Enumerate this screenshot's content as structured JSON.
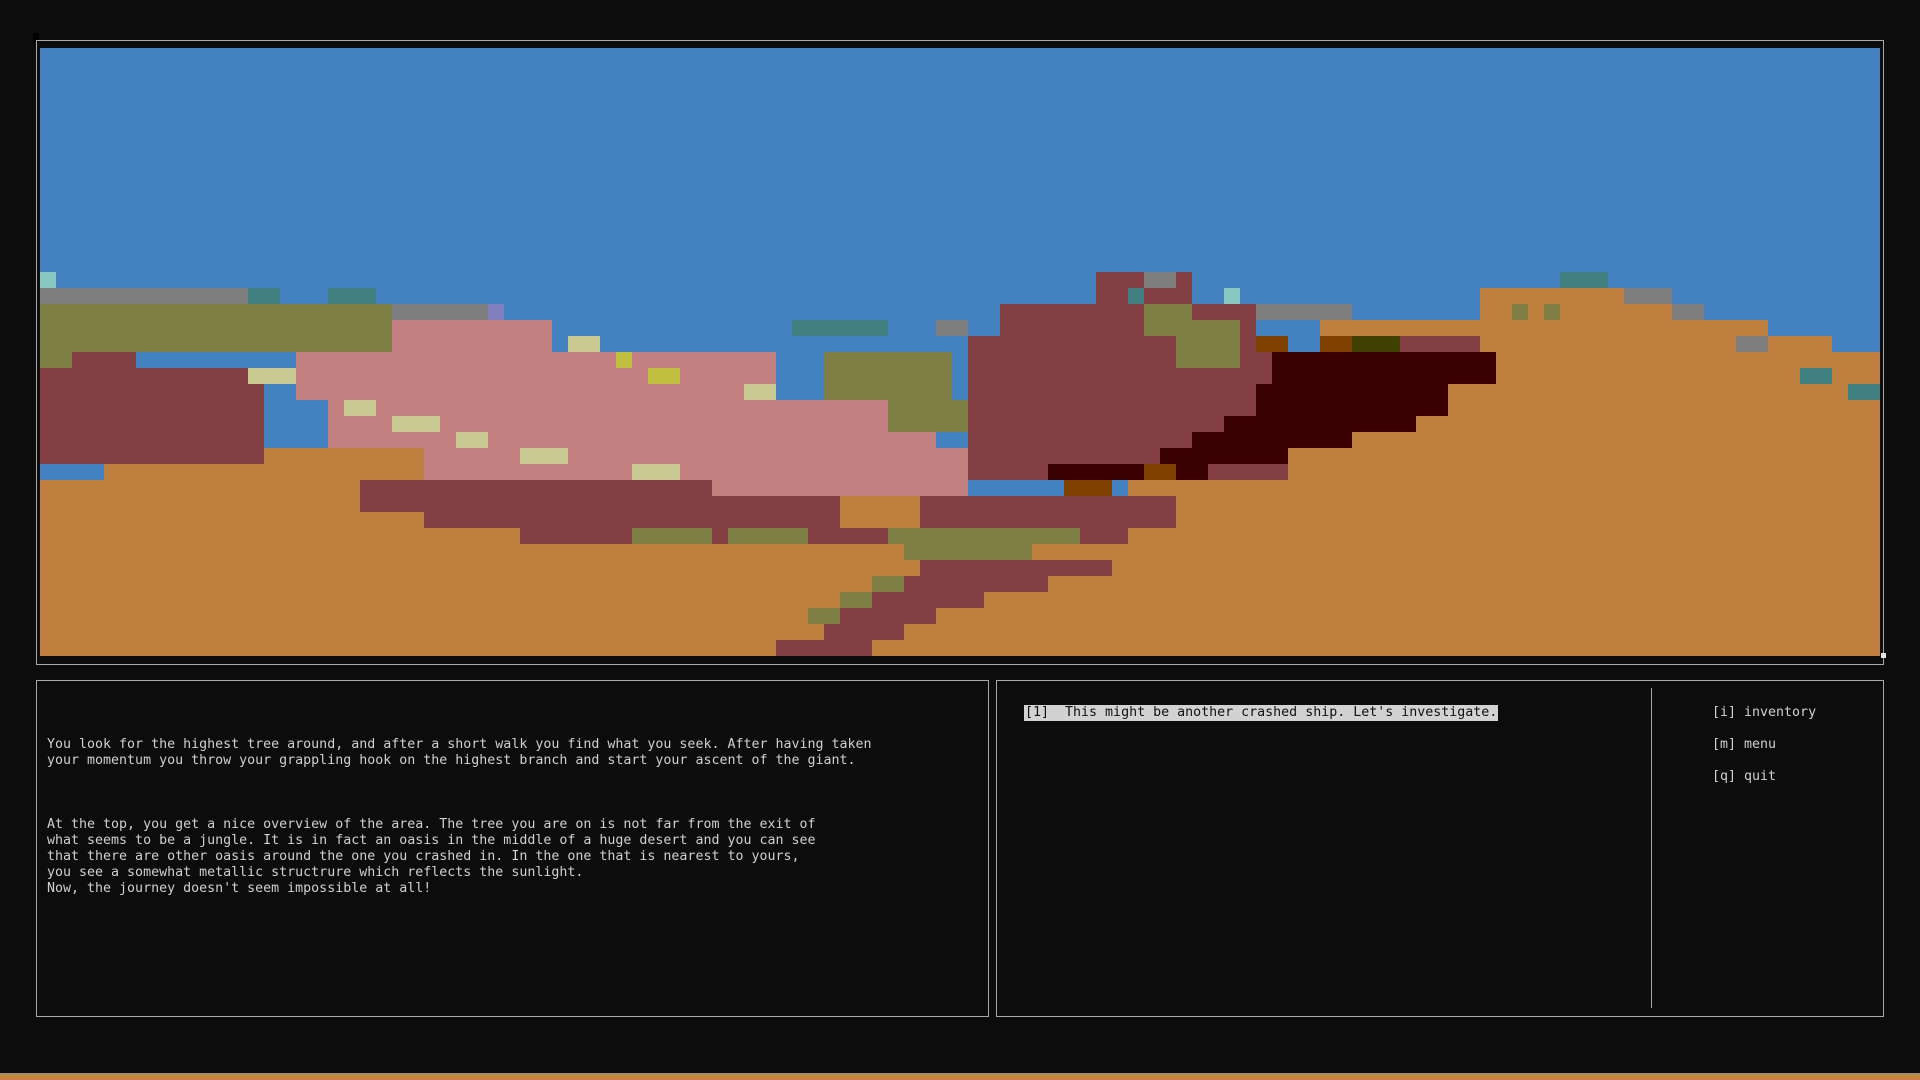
{
  "scene": {
    "palette": {
      "sky": "#4381c1",
      "sand": "#c08040",
      "olive": "#7f7f45",
      "maroon": "#843f45",
      "pink": "#c48080",
      "dark": "#380000",
      "grey": "#7f7f7f",
      "teal": "#3f7f7f",
      "pale": "#c8c890",
      "lavender": "#8080c0",
      "brown": "#804000",
      "yellow": "#c0c040"
    }
  },
  "story": {
    "paragraphs": [
      "You look for the highest tree around, and after a short walk you find what you seek. After having taken\nyour momentum you throw your grappling hook on the highest branch and start your ascent of the giant.",
      "At the top, you get a nice overview of the area. The tree you are on is not far from the exit of\nwhat seems to be a jungle. It is in fact an oasis in the middle of a huge desert and you can see\nthat there are other oasis around the one you crashed in. In the one that is nearest to yours,\nyou see a somewhat metallic structrure which reflects the sunlight.\nNow, the journey doesn't seem impossible at all!"
    ]
  },
  "choices": [
    "[1]  This might be another crashed ship. Let's investigate."
  ],
  "hotkeys": {
    "inventory": "[i] inventory",
    "menu": "[m] menu",
    "quit": "[q] quit"
  },
  "accent": "#c68442"
}
